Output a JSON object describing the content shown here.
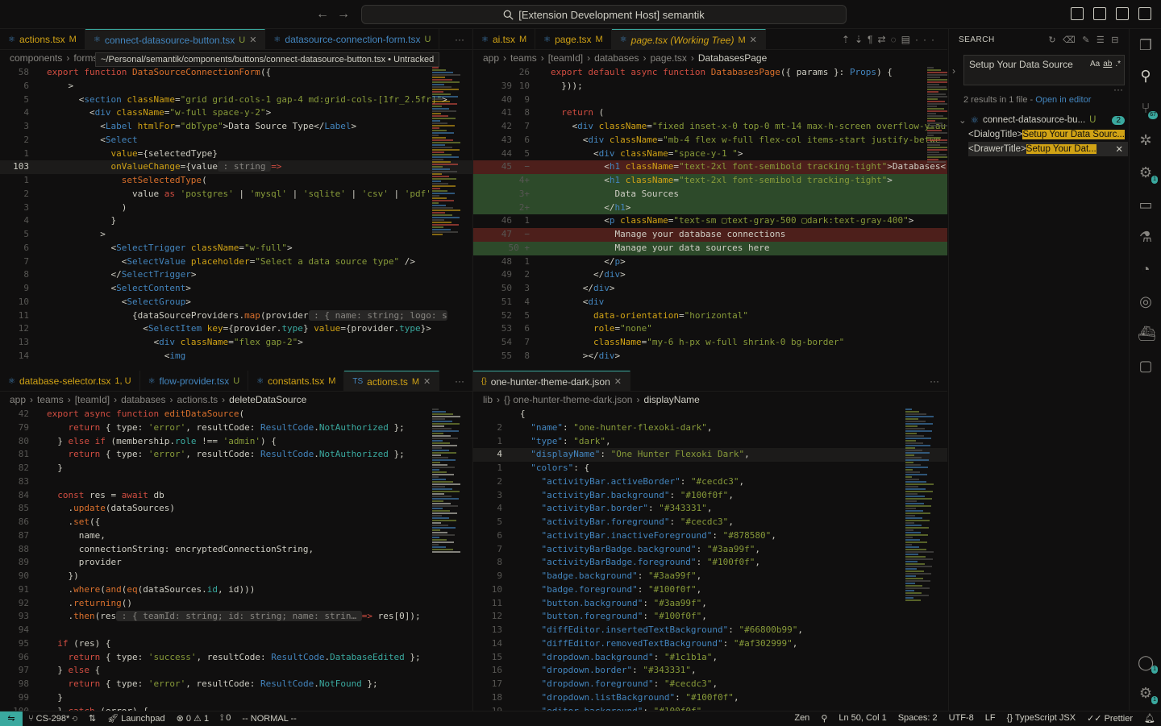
{
  "titlebar": {
    "title": "[Extension Development Host] semantik",
    "back": "←",
    "forward": "→"
  },
  "group1": {
    "tabs": [
      {
        "label": "actions.tsx",
        "status": "M"
      },
      {
        "label": "connect-datasource-button.tsx",
        "status": "U"
      },
      {
        "label": "datasource-connection-form.tsx",
        "status": "U"
      }
    ],
    "breadcrumb": [
      "components",
      "forms"
    ],
    "tooltip": "~/Personal/semantik/components/buttons/connect-datasource-button.tsx • Untracked",
    "lines": [
      {
        "n": "58",
        "html": "<span class='k'>export</span> <span class='k'>function</span> <span class='f'>DataSourceConnectionForm</span>({"
      },
      {
        "n": "6",
        "html": "    >"
      },
      {
        "n": "5",
        "html": "      &lt;<span class='t'>section</span> <span class='y'>className</span>=<span class='s'>\"grid grid-cols-1 gap-4 md:grid-cols-[1fr_2.5fr]\"</span>>"
      },
      {
        "n": "4",
        "html": "        &lt;<span class='t'>div</span> <span class='y'>className</span>=<span class='s'>\"w-full space-y-2\"</span>>"
      },
      {
        "n": "3",
        "html": "          &lt;<span class='t'>Label</span> <span class='y'>htmlFor</span>=<span class='s'>\"dbType\"</span>>Data Source Type&lt;/<span class='t'>Label</span>>"
      },
      {
        "n": "2",
        "html": "          &lt;<span class='t'>Select</span>"
      },
      {
        "n": "1",
        "html": "            <span class='y'>value</span>={selectedType}"
      },
      {
        "n": "103",
        "html": "            <span class='y'>onValueChange</span>={<span class='w'>value</span><span class='hint'> : string </span><span class='k'>=></span>",
        "cur": true
      },
      {
        "n": "1",
        "html": "              <span class='f'>setSelectedType</span>("
      },
      {
        "n": "2",
        "html": "                value <span class='k'>as</span> <span class='s'>'postgres'</span> | <span class='s'>'mysql'</span> | <span class='s'>'sqlite'</span> | <span class='s'>'csv'</span> | <span class='s'>'pdf'</span>"
      },
      {
        "n": "3",
        "html": "              )"
      },
      {
        "n": "4",
        "html": "            }"
      },
      {
        "n": "5",
        "html": "          >"
      },
      {
        "n": "6",
        "html": "            &lt;<span class='t'>SelectTrigger</span> <span class='y'>className</span>=<span class='s'>\"w-full\"</span>>"
      },
      {
        "n": "7",
        "html": "              &lt;<span class='t'>SelectValue</span> <span class='y'>placeholder</span>=<span class='s'>\"Select a data source type\"</span> />"
      },
      {
        "n": "8",
        "html": "            &lt;/<span class='t'>SelectTrigger</span>>"
      },
      {
        "n": "9",
        "html": "            &lt;<span class='t'>SelectContent</span>>"
      },
      {
        "n": "10",
        "html": "              &lt;<span class='t'>SelectGroup</span>>"
      },
      {
        "n": "11",
        "html": "                {<span class='w'>dataSourceProviders</span>.<span class='f'>map</span>(<span class='w'>provider</span><span class='hint'> : { name: string; logo: s</span>"
      },
      {
        "n": "12",
        "html": "                  &lt;<span class='t'>SelectItem</span> <span class='y'>key</span>={provider.<span class='a'>type</span>} <span class='y'>value</span>={provider.<span class='a'>type</span>}>"
      },
      {
        "n": "13",
        "html": "                    &lt;<span class='t'>div</span> <span class='y'>className</span>=<span class='s'>\"flex gap-2\"</span>>"
      },
      {
        "n": "14",
        "html": "                      &lt;<span class='t'>img</span>"
      }
    ]
  },
  "group2": {
    "tabs": [
      {
        "label": "ai.tsx",
        "status": "M"
      },
      {
        "label": "page.tsx",
        "status": "M"
      },
      {
        "label": "page.tsx (Working Tree)",
        "status": "M"
      }
    ],
    "breadcrumb": [
      "app",
      "teams",
      "[teamId]",
      "databases",
      "page.tsx",
      "DatabasesPage"
    ],
    "lines": [
      {
        "n1": "",
        "n2": "26",
        "html": "<span class='k'>export</span> <span class='k'>default</span> <span class='k'>async</span> <span class='k'>function</span> <span class='f'>DatabasesPage</span>({ <span class='w'>params</span> }: <span class='t'>Props</span>) {"
      },
      {
        "n1": "39",
        "n2": "10",
        "html": "  }));"
      },
      {
        "n1": "40",
        "n2": "9",
        "html": ""
      },
      {
        "n1": "41",
        "n2": "8",
        "html": "  <span class='k'>return</span> ("
      },
      {
        "n1": "42",
        "n2": "7",
        "html": "    &lt;<span class='t'>div</span> <span class='y'>className</span>=<span class='s'>\"fixed inset-x-0 top-0 mt-14 max-h-screen overflow-y-au</span>"
      },
      {
        "n1": "43",
        "n2": "6",
        "html": "      &lt;<span class='t'>div</span> <span class='y'>className</span>=<span class='s'>\"mb-4 flex w-full flex-col items-start justify-betwe</span>"
      },
      {
        "n1": "44",
        "n2": "5",
        "html": "        &lt;<span class='t'>div</span> <span class='y'>className</span>=<span class='s'>\"space-y-1 \"</span>>"
      },
      {
        "n1": "45",
        "n2": "−",
        "html": "          &lt;<span class='t'>h1</span> <span class='y'>className</span>=<span class='s'>\"text-2xl font-semibold tracking-tight\"</span>>Databases&lt;",
        "kind": "del"
      },
      {
        "n1": "",
        "n2": "4+",
        "html": "          &lt;<span class='t'>h1</span> <span class='y'>className</span>=<span class='s'>\"text-2xl font-semibold tracking-tight\"</span>>",
        "kind": "add"
      },
      {
        "n1": "",
        "n2": "3+",
        "html": "            Data Sources",
        "kind": "add"
      },
      {
        "n1": "",
        "n2": "2+",
        "html": "          &lt;/<span class='t'>h1</span>>",
        "kind": "add"
      },
      {
        "n1": "46",
        "n2": "1",
        "html": "          &lt;<span class='t'>p</span> <span class='y'>className</span>=<span class='s'>\"text-sm ▢text-gray-500 ▢dark:text-gray-400\"</span>>"
      },
      {
        "n1": "47",
        "n2": "−",
        "html": "            Manage your database connections",
        "kind": "del"
      },
      {
        "n1": "",
        "n2": "50 +",
        "html": "            Manage your data sources here",
        "kind": "add"
      },
      {
        "n1": "48",
        "n2": "1",
        "html": "          &lt;/<span class='t'>p</span>>"
      },
      {
        "n1": "49",
        "n2": "2",
        "html": "        &lt;/<span class='t'>div</span>>"
      },
      {
        "n1": "50",
        "n2": "3",
        "html": "      &lt;/<span class='t'>div</span>>"
      },
      {
        "n1": "51",
        "n2": "4",
        "html": "      &lt;<span class='t'>div</span>"
      },
      {
        "n1": "52",
        "n2": "5",
        "html": "        <span class='y'>data-orientation</span>=<span class='s'>\"horizontal\"</span>"
      },
      {
        "n1": "53",
        "n2": "6",
        "html": "        <span class='y'>role</span>=<span class='s'>\"none\"</span>"
      },
      {
        "n1": "54",
        "n2": "7",
        "html": "        <span class='y'>className</span>=<span class='s'>\"my-6 h-px w-full shrink-0 bg-border\"</span>"
      },
      {
        "n1": "55",
        "n2": "8",
        "html": "      >&lt;/<span class='t'>div</span>>"
      }
    ]
  },
  "group3": {
    "tabs": [
      {
        "label": "database-selector.tsx",
        "status": "1, U"
      },
      {
        "label": "flow-provider.tsx",
        "status": "U"
      },
      {
        "label": "constants.tsx",
        "status": "M"
      },
      {
        "label": "actions.ts",
        "status": "M"
      }
    ],
    "breadcrumb": [
      "app",
      "teams",
      "[teamId]",
      "databases",
      "actions.ts",
      "deleteDataSource"
    ],
    "lines": [
      {
        "n": "42",
        "html": "<span class='k'>export</span> <span class='k'>async</span> <span class='k'>function</span> <span class='f'>editDataSource</span>("
      },
      {
        "n": "79",
        "html": "    <span class='k'>return</span> { <span class='w'>type</span>: <span class='s'>'error'</span>, <span class='w'>resultCode</span>: <span class='t'>ResultCode</span>.<span class='a'>NotAuthorized</span> };"
      },
      {
        "n": "80",
        "html": "  } <span class='k'>else if</span> (<span class='w'>membership</span>.<span class='a'>role</span> !== <span class='s'>'admin'</span>) {"
      },
      {
        "n": "81",
        "html": "    <span class='k'>return</span> { <span class='w'>type</span>: <span class='s'>'error'</span>, <span class='w'>resultCode</span>: <span class='t'>ResultCode</span>.<span class='a'>NotAuthorized</span> };"
      },
      {
        "n": "82",
        "html": "  }"
      },
      {
        "n": "83",
        "html": ""
      },
      {
        "n": "84",
        "html": "  <span class='k'>const</span> <span class='w'>res</span> = <span class='k'>await</span> db"
      },
      {
        "n": "85",
        "html": "    .<span class='f'>update</span>(dataSources)"
      },
      {
        "n": "86",
        "html": "    .<span class='f'>set</span>({"
      },
      {
        "n": "87",
        "html": "      name,"
      },
      {
        "n": "88",
        "html": "      <span class='w'>connectionString</span>: encryptedConnectionString,"
      },
      {
        "n": "89",
        "html": "      provider"
      },
      {
        "n": "90",
        "html": "    })"
      },
      {
        "n": "91",
        "html": "    .<span class='f'>where</span>(<span class='f'>and</span>(<span class='f'>eq</span>(dataSources.<span class='a'>id</span>, id)))"
      },
      {
        "n": "92",
        "html": "    .<span class='f'>returning</span>()"
      },
      {
        "n": "93",
        "html": "    .<span class='f'>then</span>(<span class='w'>res</span><span class='hint'> : { teamId: string; id: string; name: strin… </span><span class='k'>=></span> res[0]);"
      },
      {
        "n": "94",
        "html": ""
      },
      {
        "n": "95",
        "html": "  <span class='k'>if</span> (res) {"
      },
      {
        "n": "96",
        "html": "    <span class='k'>return</span> { <span class='w'>type</span>: <span class='s'>'success'</span>, <span class='w'>resultCode</span>: <span class='t'>ResultCode</span>.<span class='a'>DatabaseEdited</span> };"
      },
      {
        "n": "97",
        "html": "  } <span class='k'>else</span> {"
      },
      {
        "n": "98",
        "html": "    <span class='k'>return</span> { <span class='w'>type</span>: <span class='s'>'error'</span>, <span class='w'>resultCode</span>: <span class='t'>ResultCode</span>.<span class='a'>NotFound</span> };"
      },
      {
        "n": "99",
        "html": "  }"
      },
      {
        "n": "100",
        "html": "  } <span class='k'>catch</span> (error) {"
      }
    ]
  },
  "group4": {
    "tabs": [
      {
        "label": "one-hunter-theme-dark.json",
        "status": ""
      }
    ],
    "breadcrumb": [
      "lib",
      "{} one-hunter-theme-dark.json",
      "displayName"
    ],
    "lines": [
      {
        "n": "",
        "html": "{"
      },
      {
        "n": "2",
        "html": "  <span class='t'>\"name\"</span>: <span class='s'>\"one-hunter-flexoki-dark\"</span>,"
      },
      {
        "n": "1",
        "html": "  <span class='t'>\"type\"</span>: <span class='s'>\"dark\"</span>,"
      },
      {
        "n": "4",
        "html": "  <span class='t'>\"displayName\"</span>: <span class='s'>\"One Hunter Flexoki Dark\"</span>,",
        "cur": true
      },
      {
        "n": "1",
        "html": "  <span class='t'>\"colors\"</span>: {"
      },
      {
        "n": "2",
        "html": "    <span class='t'>\"activityBar.activeBorder\"</span>: <span class='s'>\"#cecdc3\"</span>,"
      },
      {
        "n": "3",
        "html": "    <span class='t'>\"activityBar.background\"</span>: <span class='s'>\"#100f0f\"</span>,"
      },
      {
        "n": "4",
        "html": "    <span class='t'>\"activityBar.border\"</span>: <span class='s'>\"#343331\"</span>,"
      },
      {
        "n": "5",
        "html": "    <span class='t'>\"activityBar.foreground\"</span>: <span class='s'>\"#cecdc3\"</span>,"
      },
      {
        "n": "6",
        "html": "    <span class='t'>\"activityBar.inactiveForeground\"</span>: <span class='s'>\"#878580\"</span>,"
      },
      {
        "n": "7",
        "html": "    <span class='t'>\"activityBarBadge.background\"</span>: <span class='s'>\"#3aa99f\"</span>,"
      },
      {
        "n": "8",
        "html": "    <span class='t'>\"activityBarBadge.foreground\"</span>: <span class='s'>\"#100f0f\"</span>,"
      },
      {
        "n": "9",
        "html": "    <span class='t'>\"badge.background\"</span>: <span class='s'>\"#3aa99f\"</span>,"
      },
      {
        "n": "10",
        "html": "    <span class='t'>\"badge.foreground\"</span>: <span class='s'>\"#100f0f\"</span>,"
      },
      {
        "n": "11",
        "html": "    <span class='t'>\"button.background\"</span>: <span class='s'>\"#3aa99f\"</span>,"
      },
      {
        "n": "12",
        "html": "    <span class='t'>\"button.foreground\"</span>: <span class='s'>\"#100f0f\"</span>,"
      },
      {
        "n": "13",
        "html": "    <span class='t'>\"diffEditor.insertedTextBackground\"</span>: <span class='s'>\"#66800b99\"</span>,"
      },
      {
        "n": "14",
        "html": "    <span class='t'>\"diffEditor.removedTextBackground\"</span>: <span class='s'>\"#af302999\"</span>,"
      },
      {
        "n": "15",
        "html": "    <span class='t'>\"dropdown.background\"</span>: <span class='s'>\"#1c1b1a\"</span>,"
      },
      {
        "n": "16",
        "html": "    <span class='t'>\"dropdown.border\"</span>: <span class='s'>\"#343331\"</span>,"
      },
      {
        "n": "17",
        "html": "    <span class='t'>\"dropdown.foreground\"</span>: <span class='s'>\"#cecdc3\"</span>,"
      },
      {
        "n": "18",
        "html": "    <span class='t'>\"dropdown.listBackground\"</span>: <span class='s'>\"#100f0f\"</span>,"
      },
      {
        "n": "19",
        "html": "    <span class='t'>\"editor.background\"</span>: <span class='s'>\"#100f0f\"</span>,"
      }
    ]
  },
  "search": {
    "header": "SEARCH",
    "query": "Setup Your Data Source",
    "summary": "2 results in 1 file - ",
    "open_in_editor": "Open in editor",
    "file": {
      "name": "connect-datasource-bu...",
      "status": "U",
      "count": "2"
    },
    "results": [
      {
        "prefix": "<DialogTitle>",
        "match": "Setup Your Data Sourc..."
      },
      {
        "prefix": "<DrawerTitle>",
        "match": "Setup Your Dat..."
      }
    ],
    "opt_case": "Aa",
    "opt_word": "ab",
    "opt_regex": ".*"
  },
  "activity": {
    "scm_badge": "67",
    "ext_badge": "1",
    "account_badge": "1",
    "settings_badge": "1"
  },
  "status": {
    "branch": "CS-298*",
    "launchpad": "Launchpad",
    "errors": "0",
    "warnings": "1",
    "ports": "0",
    "mode": "-- NORMAL --",
    "zen": "Zen",
    "position": "Ln 50, Col 1",
    "spaces": "Spaces: 2",
    "encoding": "UTF-8",
    "eol": "LF",
    "language": "TypeScript JSX",
    "prettier": "Prettier"
  },
  "colors": {
    "accent": "#3aa99f",
    "bg": "#100f0f",
    "fg": "#cecdc3",
    "match": "#d0a215"
  }
}
